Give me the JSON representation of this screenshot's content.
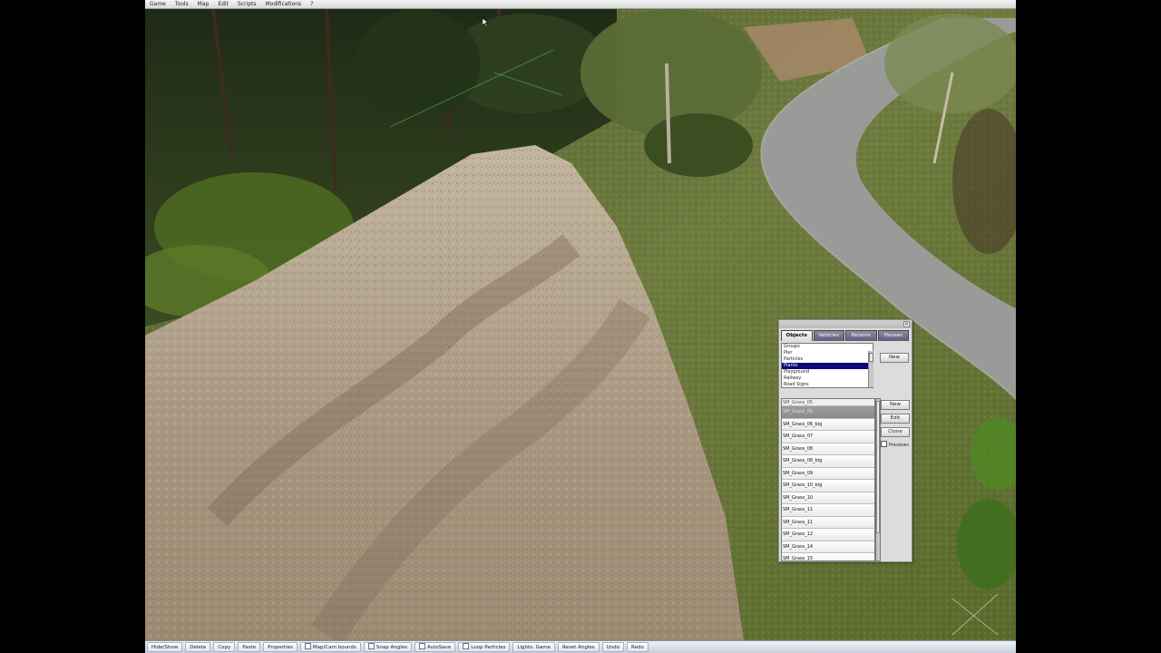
{
  "menubar": {
    "items": [
      "Game",
      "Tools",
      "Map",
      "Edit",
      "Scripts",
      "Modifications",
      "?"
    ]
  },
  "toolbar": {
    "items": [
      "Hide/Show",
      "Delete",
      "Copy",
      "Paste",
      "Properties",
      "Map/Cam bounds",
      "Snap Angles",
      "AutoSave",
      "Loop Particles",
      "Lights: Game",
      "Reset Angles",
      "Undo",
      "Redo"
    ]
  },
  "panel": {
    "tabs": [
      "Objects",
      "Vehicles",
      "Persons",
      "Houses"
    ],
    "active_tab": "Objects",
    "categories": [
      "Groups",
      "Pier",
      "Particles",
      "Plants",
      "Playground",
      "Railway",
      "Road Signs"
    ],
    "selected_category": "Plants",
    "buttons": {
      "new_category": "New",
      "new": "New",
      "edit": "Edit",
      "clone": "Clone"
    },
    "previews_label": "Previews",
    "list_header": "SM_Grass_05",
    "objects": [
      "SM_Grass_06",
      "SM_Grass_06_big",
      "SM_Grass_07",
      "SM_Grass_08",
      "SM_Grass_08_big",
      "SM_Grass_09",
      "SM_Grass_10_big",
      "SM_Grass_10",
      "SM_Grass_11",
      "SM_Grass_11",
      "SM_Grass_12",
      "SM_Grass_14",
      "SM_Grass_15"
    ],
    "selected_object": "SM_Grass_06"
  },
  "colors": {
    "selection": "#0a0a7a",
    "road": "#9a9b98",
    "gravel": "#b4a48c",
    "grass": "#6c7a3e"
  }
}
